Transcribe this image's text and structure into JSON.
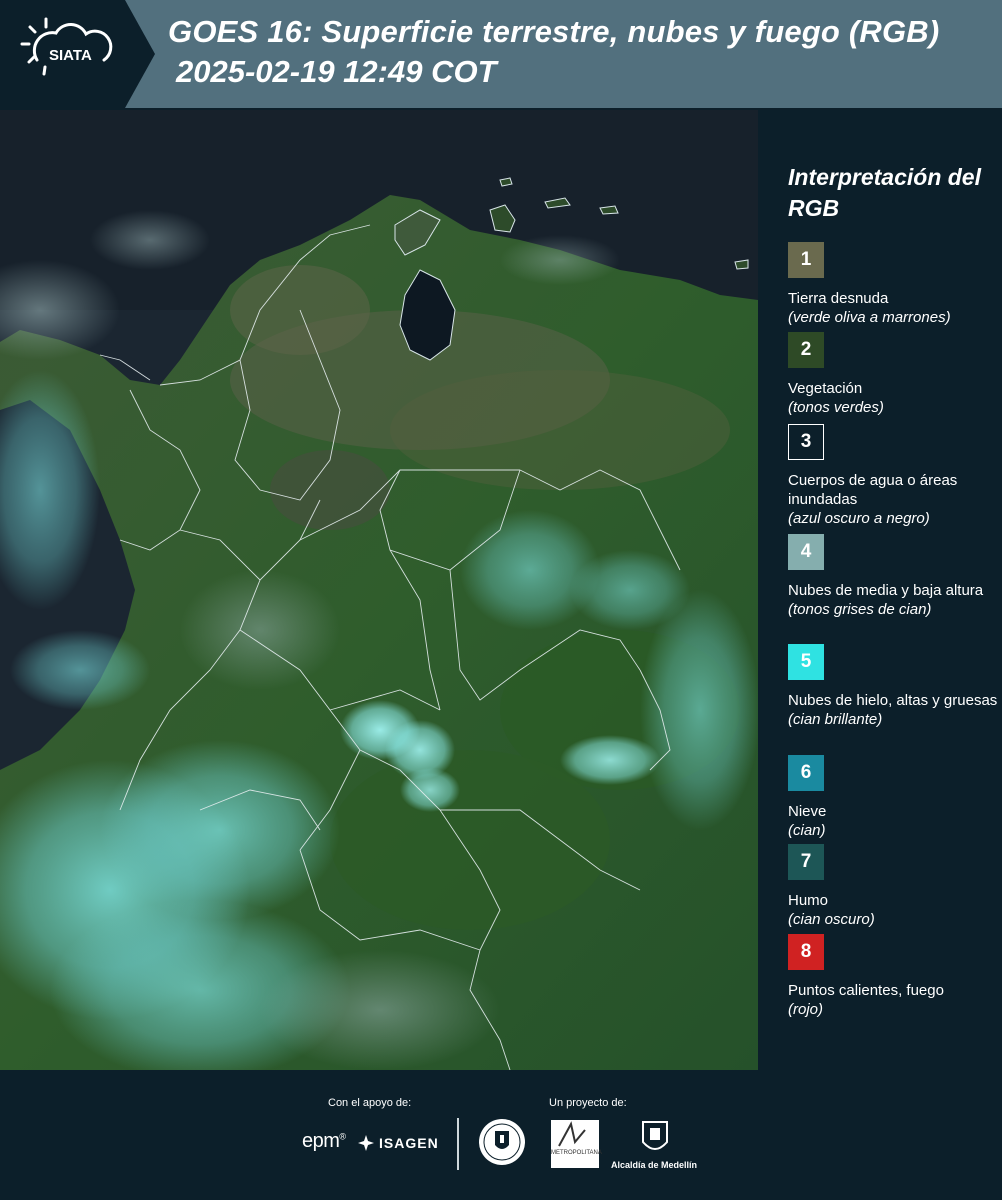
{
  "header": {
    "logo_text": "SIATA",
    "title_line1": "GOES 16: Superficie terrestre, nubes y fuego (RGB)",
    "title_line2": "2025-02-19 12:49 COT"
  },
  "legend": {
    "title": "Interpretación del RGB",
    "items": [
      {
        "number": "1",
        "label": "Tierra desnuda",
        "sub": "(verde oliva a marrones)",
        "color": "#6a6a4e"
      },
      {
        "number": "2",
        "label": "Vegetación",
        "sub": "(tonos verdes)",
        "color": "#2e4a26"
      },
      {
        "number": "3",
        "label": "Cuerpos de agua o áreas inundadas",
        "sub": "(azul oscuro a negro)",
        "color": "#0c1f2a"
      },
      {
        "number": "4",
        "label": "Nubes de media y baja altura",
        "sub": "(tonos grises de cian)",
        "color": "#85aeae"
      },
      {
        "number": "5",
        "label": "Nubes de hielo, altas y gruesas",
        "sub": "(cian brillante)",
        "color": "#2fe2e2"
      },
      {
        "number": "6",
        "label": "Nieve",
        "sub": "(cian)",
        "color": "#1a8aa0"
      },
      {
        "number": "7",
        "label": "Humo",
        "sub": "(cian oscuro)",
        "color": "#1d5656"
      },
      {
        "number": "8",
        "label": "Puntos calientes, fuego",
        "sub": "(rojo)",
        "color": "#d02222"
      }
    ]
  },
  "footer": {
    "support_label": "Con el apoyo de:",
    "project_label": "Un proyecto de:",
    "epm": "epm",
    "isagen": "ISAGEN",
    "area_metropolitana": "METROPOLITANA",
    "alcaldia": "Alcaldía de Medellín"
  },
  "colors": {
    "header_bg": "#52707e",
    "page_bg": "#0c1f2a"
  }
}
